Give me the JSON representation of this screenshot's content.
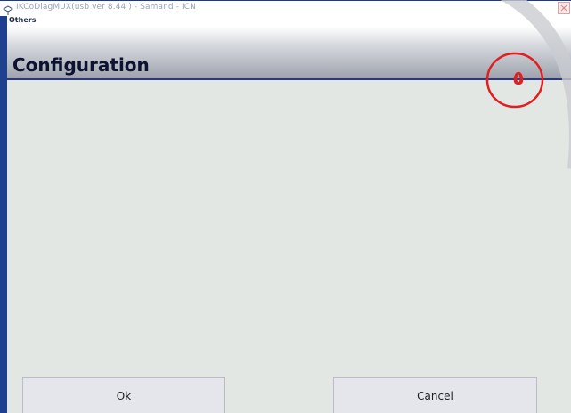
{
  "window": {
    "title": "IKCoDiagMUX(usb ver 8.44 ) - Samand - ICN",
    "app_icon": "diagnostic-connector-icon",
    "close_icon": "close-icon"
  },
  "menu": {
    "items": [
      "Others"
    ]
  },
  "header": {
    "title": "Configuration"
  },
  "annotation": {
    "badge_text": "٥",
    "circle_color": "#e02020"
  },
  "footer": {
    "ok_label": "Ok",
    "cancel_label": "Cancel"
  },
  "colors": {
    "accent": "#1f3f8f",
    "header_text": "#0c1230",
    "background": "#e3e7e3"
  }
}
